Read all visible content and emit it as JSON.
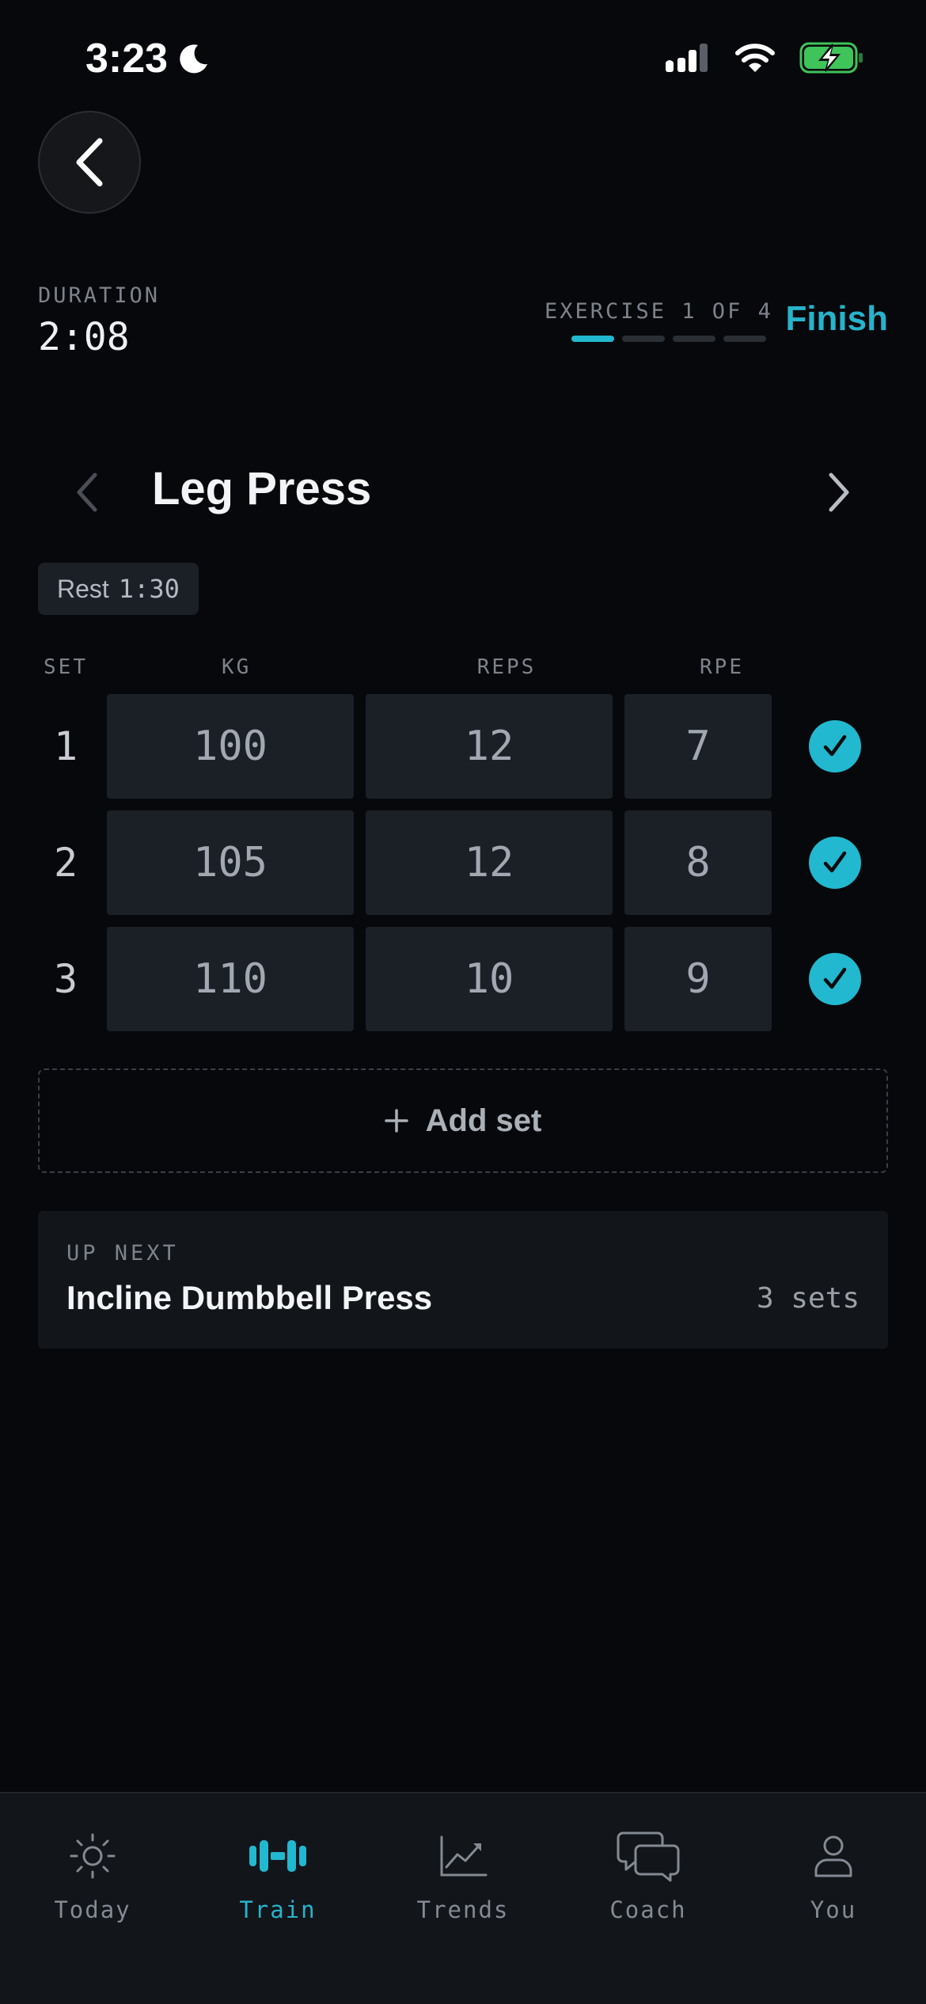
{
  "status_bar": {
    "time": "3:23"
  },
  "header": {
    "duration_label": "DURATION",
    "duration_value": "2:08",
    "exercise_progress": "EXERCISE 1 OF 4",
    "exercise_current": 1,
    "exercise_total": 4,
    "finish_label": "Finish"
  },
  "exercise": {
    "name": "Leg Press",
    "rest_label": "Rest",
    "rest_value": "1:30"
  },
  "table": {
    "headers": {
      "set": "SET",
      "kg": "KG",
      "reps": "REPS",
      "rpe": "RPE"
    },
    "rows": [
      {
        "set": "1",
        "kg": "100",
        "reps": "12",
        "rpe": "7",
        "done": true
      },
      {
        "set": "2",
        "kg": "105",
        "reps": "12",
        "rpe": "8",
        "done": true
      },
      {
        "set": "3",
        "kg": "110",
        "reps": "10",
        "rpe": "9",
        "done": true
      }
    ]
  },
  "add_set_label": "Add set",
  "up_next": {
    "label": "UP NEXT",
    "name": "Incline Dumbbell Press",
    "sets": "3 sets"
  },
  "nav": {
    "items": [
      {
        "label": "Today",
        "icon": "sun-icon"
      },
      {
        "label": "Train",
        "icon": "dumbbell-icon",
        "active": true
      },
      {
        "label": "Trends",
        "icon": "chart-icon"
      },
      {
        "label": "Coach",
        "icon": "chat-icon"
      },
      {
        "label": "You",
        "icon": "person-icon"
      }
    ]
  },
  "colors": {
    "accent": "#22b8cf",
    "background": "#07080b",
    "cell": "#1b2027"
  }
}
